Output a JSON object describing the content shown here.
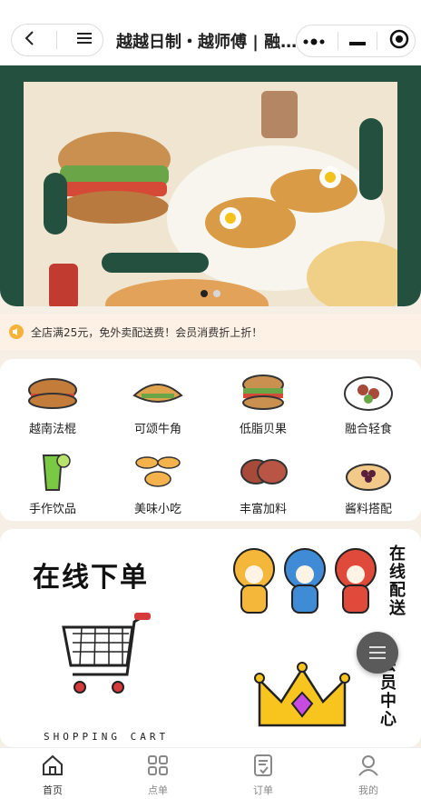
{
  "header": {
    "title": "越越日制・越师傅 | 融..."
  },
  "banner": {
    "slides": 2,
    "active_slide": 0
  },
  "notice": {
    "text": "全店满25元，免外卖配送费！会员消费折上折！"
  },
  "categories": [
    {
      "label": "越南法棍",
      "icon": "baguette-icon"
    },
    {
      "label": "可颂牛角",
      "icon": "croissant-icon"
    },
    {
      "label": "低脂贝果",
      "icon": "bagel-icon"
    },
    {
      "label": "融合轻食",
      "icon": "salad-icon"
    },
    {
      "label": "手作饮品",
      "icon": "drink-icon"
    },
    {
      "label": "美味小吃",
      "icon": "snack-icon"
    },
    {
      "label": "丰富加料",
      "icon": "meat-icon"
    },
    {
      "label": "酱料搭配",
      "icon": "sauce-icon"
    }
  ],
  "promo": {
    "online_title": "在线下单",
    "cart_caption": "SHOPPING CART",
    "delivery": [
      "在",
      "线",
      "配",
      "送"
    ],
    "member": [
      "会",
      "员",
      "中",
      "心"
    ]
  },
  "tabbar": [
    {
      "label": "首页",
      "icon": "home-icon",
      "active": true
    },
    {
      "label": "点单",
      "icon": "grid-icon",
      "active": false
    },
    {
      "label": "订单",
      "icon": "order-icon",
      "active": false
    },
    {
      "label": "我的",
      "icon": "user-icon",
      "active": false
    }
  ],
  "colors": {
    "banner_green": "#24513f",
    "notice_bg": "#fdf0e4",
    "notice_icon": "#f6b33a",
    "page_bg": "#f6efe6"
  }
}
